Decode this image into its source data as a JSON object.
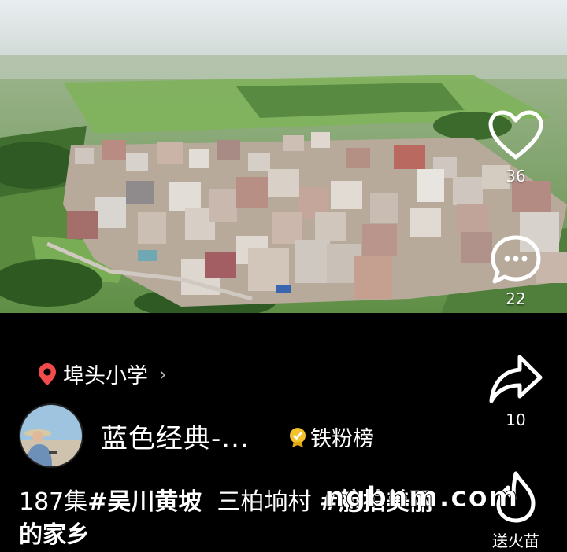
{
  "location": {
    "icon": "location-pin-icon",
    "name": "埠头小学",
    "chevron": "›"
  },
  "author": {
    "name": "蓝色经典-...",
    "badge_icon": "fan-badge-icon",
    "badge_label": "铁粉榜"
  },
  "actions": {
    "like_count": "36",
    "comment_count": "22",
    "share_count": "10",
    "gift_label": "送火苗"
  },
  "caption": {
    "prefix": "187集",
    "tag1": "#吴川黄坡",
    "middle": "  三柏垧村 ",
    "tag2": "#航拍美丽",
    "line2": "的家乡"
  },
  "watermark": "ngbnm.com",
  "colors": {
    "location_pin": "#f24b4b",
    "badge_gold": "#f3c22d",
    "background": "#000000"
  }
}
